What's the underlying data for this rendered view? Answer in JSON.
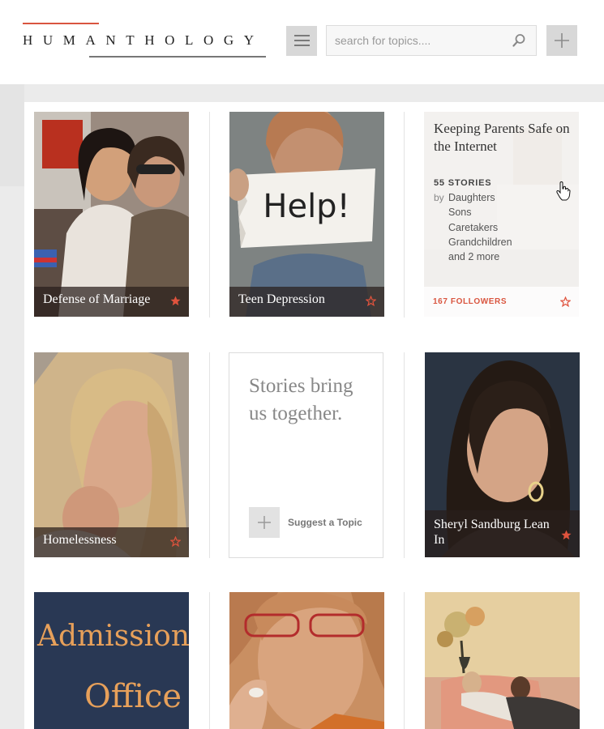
{
  "header": {
    "logo_text": "HUMANTHOLOGY",
    "search_placeholder": "search for topics....",
    "icons": {
      "menu": "hamburger-icon",
      "search": "magnifier-icon",
      "add": "plus-icon"
    }
  },
  "colors": {
    "accent": "#d9553f",
    "caption_bg": "#2b221f",
    "panel_bg": "#ffffff",
    "page_bg": "#ebebeb"
  },
  "cards": {
    "defense": {
      "title": "Defense of Marriage",
      "starred": true
    },
    "teen": {
      "title": "Teen Depression",
      "starred": false
    },
    "parents": {
      "title": "Keeping Parents Safe on the Internet",
      "stories": "55 STORIES",
      "by": "by",
      "relations": [
        "Daughters",
        "Sons",
        "Caretakers",
        "Grandchildren",
        "and 2 more"
      ],
      "followers": "167 FOLLOWERS",
      "starred": false
    },
    "homeless": {
      "title": "Homelessness",
      "starred": false
    },
    "sandberg": {
      "title": "Sheryl Sandburg Lean In",
      "starred": true
    }
  },
  "suggest": {
    "tagline": "Stories bring us together.",
    "label": "Suggest a Topic"
  },
  "images": {
    "admissions_sign": [
      "Admissions",
      "Office"
    ],
    "help_sign": "Help!"
  }
}
